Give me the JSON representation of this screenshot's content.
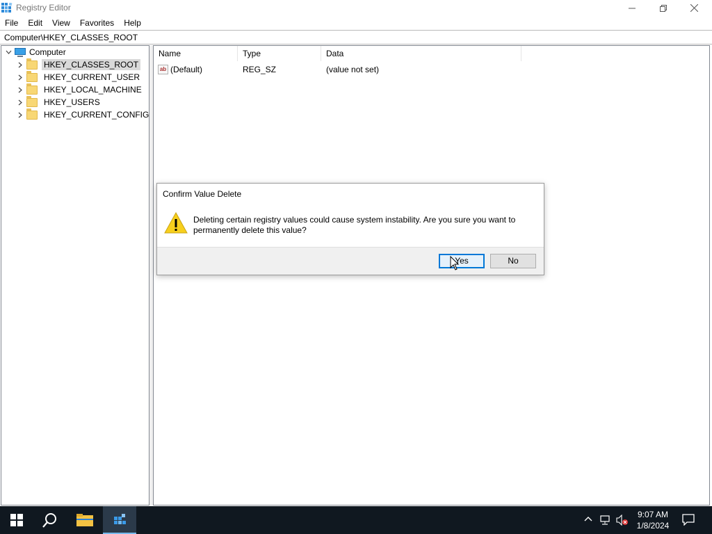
{
  "window": {
    "title": "Registry Editor",
    "icons": {
      "app": "registry-icon",
      "minimize": "minimize-icon",
      "maximize": "restore-icon",
      "close": "close-icon"
    }
  },
  "menu": [
    "File",
    "Edit",
    "View",
    "Favorites",
    "Help"
  ],
  "address": "Computer\\HKEY_CLASSES_ROOT",
  "tree": {
    "root": "Computer",
    "nodes": [
      "HKEY_CLASSES_ROOT",
      "HKEY_CURRENT_USER",
      "HKEY_LOCAL_MACHINE",
      "HKEY_USERS",
      "HKEY_CURRENT_CONFIG"
    ],
    "selected": "HKEY_CLASSES_ROOT"
  },
  "list": {
    "columns": [
      "Name",
      "Type",
      "Data"
    ],
    "rows": [
      {
        "name": "(Default)",
        "type": "REG_SZ",
        "data": "(value not set)",
        "icon": "string-value-icon"
      }
    ]
  },
  "dialog": {
    "title": "Confirm Value Delete",
    "message": "Deleting certain registry values could cause system instability. Are you sure you want to permanently delete this value?",
    "yes_label": "Yes",
    "no_label": "No",
    "icon": "warning-icon"
  },
  "taskbar": {
    "time": "9:07 AM",
    "date": "1/8/2024",
    "items": [
      "start-icon",
      "search-icon",
      "file-explorer-icon",
      "registry-editor-icon"
    ],
    "tray": [
      "chevron-up-icon",
      "network-icon",
      "volume-muted-icon",
      "notification-icon"
    ]
  },
  "colors": {
    "accent": "#0078d7",
    "taskbar": "#101820",
    "selection": "#d9d9d9"
  }
}
